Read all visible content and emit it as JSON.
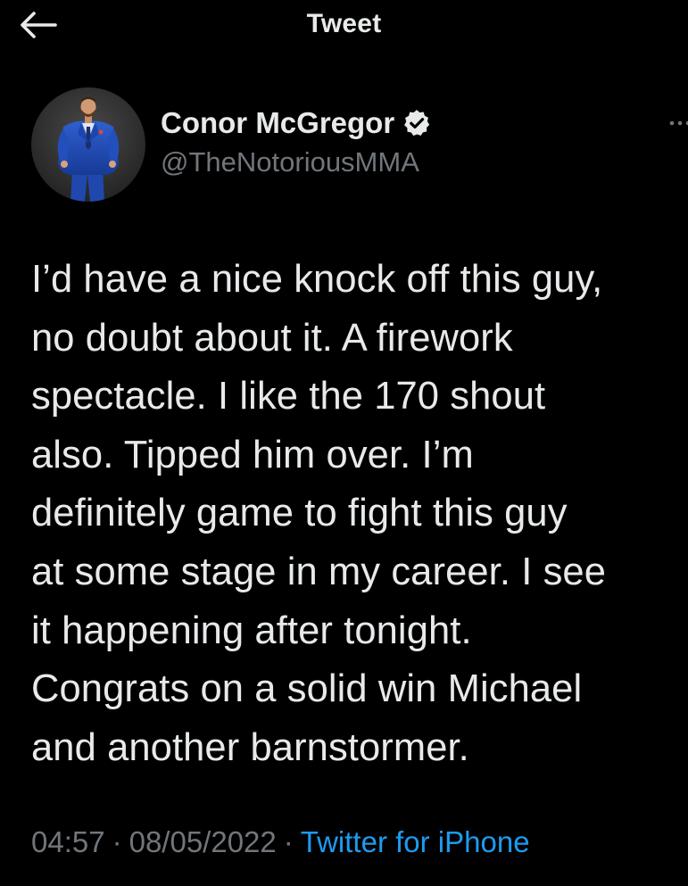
{
  "header": {
    "title": "Tweet",
    "back_icon": "arrow-left-icon"
  },
  "author": {
    "display_name": "Conor McGregor",
    "handle": "@TheNotoriousMMA",
    "verified_icon": "verified-badge-icon",
    "avatar_icon": "profile-photo",
    "more_icon": "more-options-icon"
  },
  "tweet": {
    "lines": [
      "I’d have a nice knock off this guy,",
      "no doubt about it. A firework",
      "spectacle. I like the 170 shout",
      "also. Tipped him over. I’m",
      "definitely game to fight this guy",
      "at some stage in my career. I see",
      "it happening after tonight.",
      "Congrats on a solid win Michael",
      "and another barnstormer."
    ],
    "time": "04:57",
    "date": "08/05/2022",
    "separator": "·",
    "source": "Twitter for iPhone"
  },
  "colors": {
    "background": "#000000",
    "primary_text": "#e7e9ea",
    "secondary_text": "#71767b",
    "link": "#1d9bf0",
    "verified_badge": "#e7e9ea"
  }
}
